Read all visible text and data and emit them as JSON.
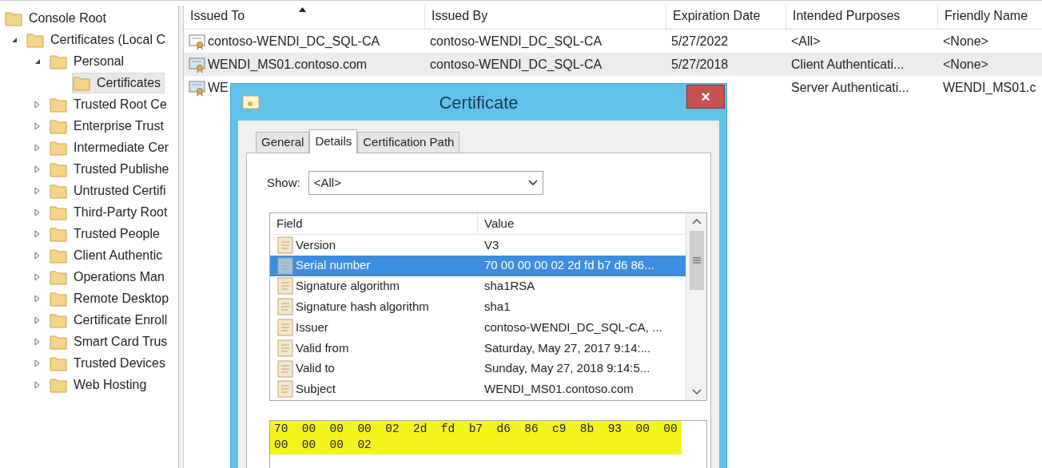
{
  "tree": [
    {
      "label": "Console Root",
      "selected": false,
      "children": [
        {
          "label": "Certificates (Local C",
          "selected": false,
          "expanded": true,
          "children": [
            {
              "label": "Personal",
              "selected": false,
              "expanded": true,
              "children": [
                {
                  "label": "Certificates",
                  "selected": true
                }
              ]
            },
            {
              "label": "Trusted Root Ce",
              "selected": false,
              "expanded": false
            },
            {
              "label": "Enterprise Trust",
              "selected": false,
              "expanded": false
            },
            {
              "label": "Intermediate Cer",
              "selected": false,
              "expanded": false
            },
            {
              "label": "Trusted Publishe",
              "selected": false,
              "expanded": false
            },
            {
              "label": "Untrusted Certifi",
              "selected": false,
              "expanded": false
            },
            {
              "label": "Third-Party Root",
              "selected": false,
              "expanded": false
            },
            {
              "label": "Trusted People",
              "selected": false,
              "expanded": false
            },
            {
              "label": "Client Authentic",
              "selected": false,
              "expanded": false
            },
            {
              "label": "Operations Man",
              "selected": false,
              "expanded": false
            },
            {
              "label": "Remote Desktop",
              "selected": false,
              "expanded": false
            },
            {
              "label": "Certificate Enroll",
              "selected": false,
              "expanded": false
            },
            {
              "label": "Smart Card Trus",
              "selected": false,
              "expanded": false
            },
            {
              "label": "Trusted Devices",
              "selected": false,
              "expanded": false
            },
            {
              "label": "Web Hosting",
              "selected": false,
              "expanded": false
            }
          ]
        }
      ]
    }
  ],
  "table": {
    "columns": [
      "Issued To",
      "Issued By",
      "Expiration Date",
      "Intended Purposes",
      "Friendly Name"
    ],
    "rows": [
      {
        "selected": false,
        "cells": [
          "contoso-WENDI_DC_SQL-CA",
          "contoso-WENDI_DC_SQL-CA",
          "5/27/2022",
          "<All>",
          "<None>"
        ]
      },
      {
        "selected": true,
        "cells": [
          "WENDI_MS01.contoso.com",
          "contoso-WENDI_DC_SQL-CA",
          "5/27/2018",
          "Client Authenticati...",
          "<None>"
        ]
      },
      {
        "selected": false,
        "cells": [
          "WE",
          null,
          null,
          "Server Authenticati...",
          "WENDI_MS01.c"
        ]
      }
    ]
  },
  "dialog": {
    "title": "Certificate",
    "close": "×",
    "tabs": [
      {
        "label": "General",
        "selected": false
      },
      {
        "label": "Details",
        "selected": true
      },
      {
        "label": "Certification Path",
        "selected": false
      }
    ],
    "show_label": "Show:",
    "show_value": "<All>",
    "columns": [
      "Field",
      "Value"
    ],
    "fields": [
      {
        "field": "Version",
        "value": "V3",
        "selected": false
      },
      {
        "field": "Serial number",
        "value": "70 00 00 00 02 2d fd b7 d6 86...",
        "selected": true
      },
      {
        "field": "Signature algorithm",
        "value": "sha1RSA",
        "selected": false
      },
      {
        "field": "Signature hash algorithm",
        "value": "sha1",
        "selected": false
      },
      {
        "field": "Issuer",
        "value": "contoso-WENDI_DC_SQL-CA, ...",
        "selected": false
      },
      {
        "field": "Valid from",
        "value": "Saturday, May 27, 2017 9:14:...",
        "selected": false
      },
      {
        "field": "Valid to",
        "value": "Sunday, May 27, 2018 9:14:5...",
        "selected": false
      },
      {
        "field": "Subject",
        "value": "WENDI_MS01.contoso.com",
        "selected": false
      }
    ],
    "detail_lines": [
      "70  00  00  00  02  2d  fd  b7  d6  86  c9  8b  93  00  00",
      "00  00  00  02"
    ]
  }
}
